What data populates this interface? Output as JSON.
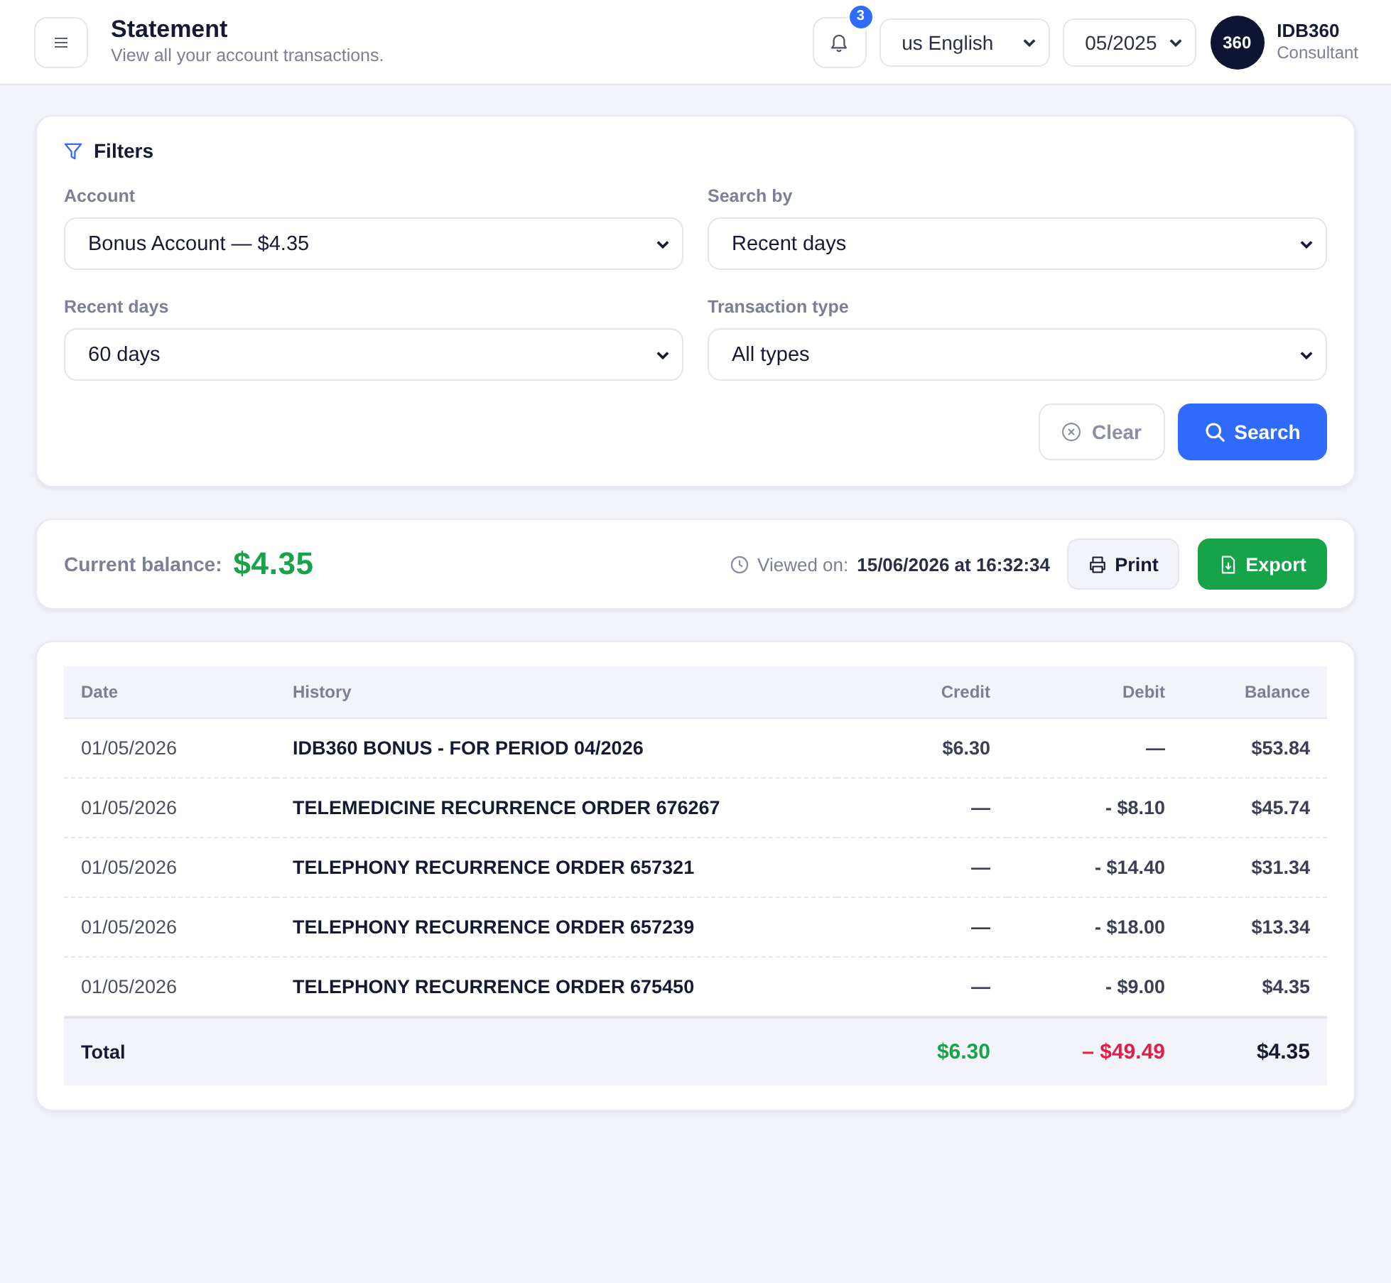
{
  "header": {
    "title": "Statement",
    "subtitle": "View all your account transactions.",
    "notification_count": "3",
    "language": "us English",
    "period": "05/2025",
    "user": {
      "avatar": "360",
      "name": "IDB360",
      "role": "Consultant"
    }
  },
  "filters": {
    "title": "Filters",
    "fields": [
      {
        "label": "Account",
        "value": "Bonus Account — $4.35"
      },
      {
        "label": "Search by",
        "value": "Recent days"
      },
      {
        "label": "Recent days",
        "value": "60 days"
      },
      {
        "label": "Transaction type",
        "value": "All types"
      }
    ],
    "buttons": [
      {
        "label": "Clear",
        "kind": "secondary"
      },
      {
        "label": "Search",
        "kind": "primary"
      }
    ]
  },
  "balance": {
    "label": "Current balance:",
    "amount": "$4.35",
    "viewed_label": "Viewed on:",
    "viewed_at": "15/06/2026 at 16:32:34",
    "buttons": [
      {
        "label": "Print",
        "kind": "print"
      },
      {
        "label": "Export",
        "kind": "export"
      }
    ]
  },
  "table": {
    "columns": [
      "Date",
      "History",
      "Credit",
      "Debit",
      "Balance"
    ],
    "rows": [
      {
        "date": "01/05/2026",
        "history": "IDB360 BONUS - FOR PERIOD 04/2026",
        "credit": "$6.30",
        "debit": "—",
        "balance": "$53.84"
      },
      {
        "date": "01/05/2026",
        "history": "TELEMEDICINE RECURRENCE ORDER 676267",
        "credit": "—",
        "debit": "- $8.10",
        "balance": "$45.74"
      },
      {
        "date": "01/05/2026",
        "history": "TELEPHONY RECURRENCE ORDER 657321",
        "credit": "—",
        "debit": "- $14.40",
        "balance": "$31.34"
      },
      {
        "date": "01/05/2026",
        "history": "TELEPHONY RECURRENCE ORDER 657239",
        "credit": "—",
        "debit": "- $18.00",
        "balance": "$13.34"
      },
      {
        "date": "01/05/2026",
        "history": "TELEPHONY RECURRENCE ORDER 675450",
        "credit": "—",
        "debit": "- $9.00",
        "balance": "$4.35"
      }
    ],
    "total": {
      "label": "Total",
      "cells": [
        {
          "value": "$6.30",
          "color": "#16a34a"
        },
        {
          "value": "– $49.49",
          "color": "#e11d48"
        },
        {
          "value": "$4.35",
          "color": "#141a33"
        }
      ]
    }
  }
}
